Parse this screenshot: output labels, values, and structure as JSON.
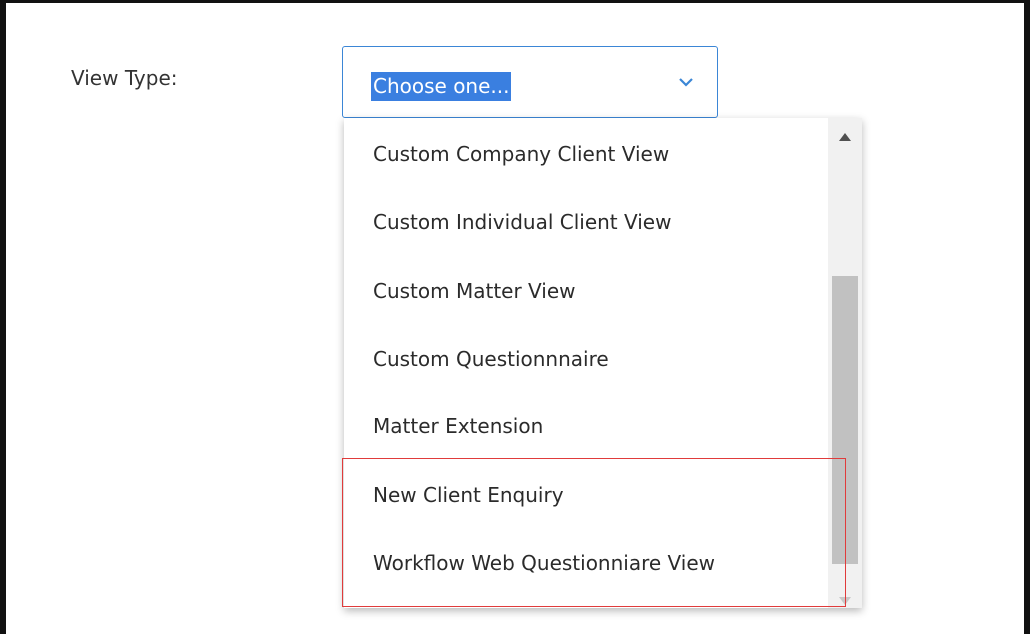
{
  "form": {
    "view_type_label": "View Type:",
    "select": {
      "value": "Choose one...",
      "icon": "chevron-down-icon",
      "accent": "#3a7fe0"
    }
  },
  "dropdown": {
    "options": [
      "Custom Company Client View",
      "Custom Individual Client View",
      "Custom Matter View",
      "Custom Questionnnaire",
      "Matter Extension",
      "New Client Enquiry",
      "Workflow Web Questionniare View"
    ],
    "highlighted_options": [
      "New Client Enquiry",
      "Workflow Web Questionniare View"
    ],
    "highlight_color": "#e03b3b",
    "scrollbar": {
      "up_icon": "scroll-up-arrow-icon",
      "down_icon": "scroll-down-arrow-icon"
    }
  }
}
